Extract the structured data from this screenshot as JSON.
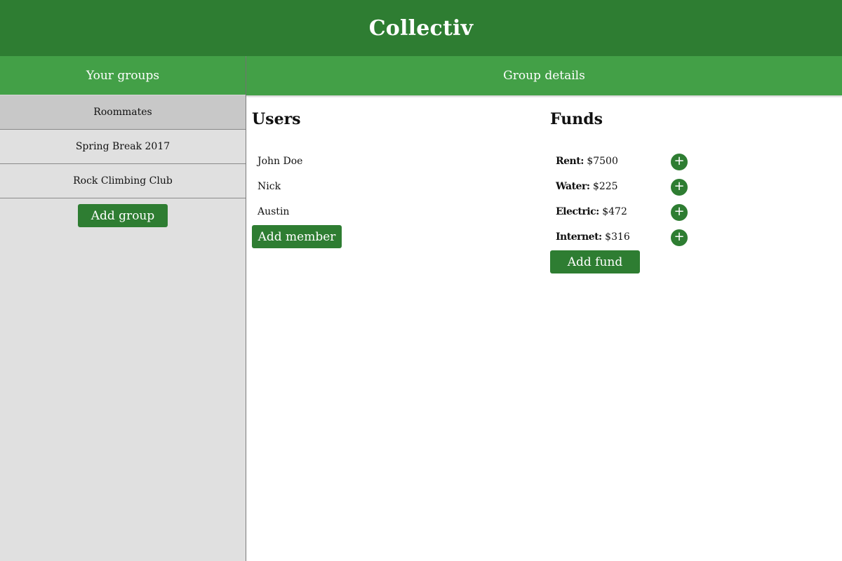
{
  "app": {
    "title": "Collectiv"
  },
  "sidebar": {
    "header": "Your groups",
    "groups": [
      {
        "name": "Roommates",
        "selected": true
      },
      {
        "name": "Spring Break 2017",
        "selected": false
      },
      {
        "name": "Rock Climbing Club",
        "selected": false
      }
    ],
    "add_group_label": "Add group"
  },
  "main": {
    "header": "Group details",
    "users": {
      "title": "Users",
      "items": [
        "John Doe",
        "Nick",
        "Austin"
      ],
      "add_label": "Add member"
    },
    "funds": {
      "title": "Funds",
      "items": [
        {
          "name": "Rent:",
          "amount": "$7500",
          "add_icon": "+"
        },
        {
          "name": "Water:",
          "amount": "$225",
          "add_icon": "+"
        },
        {
          "name": "Electric:",
          "amount": "$472",
          "add_icon": "+"
        },
        {
          "name": "Internet:",
          "amount": "$316",
          "add_icon": "+"
        }
      ],
      "add_label": "Add fund"
    }
  },
  "colors": {
    "header_bg": "#2e7d32",
    "panel_header_bg": "#43a047",
    "sidebar_bg": "#e0e0e0",
    "selected_bg": "#c8c8c8",
    "button_bg": "#2e7d32"
  }
}
